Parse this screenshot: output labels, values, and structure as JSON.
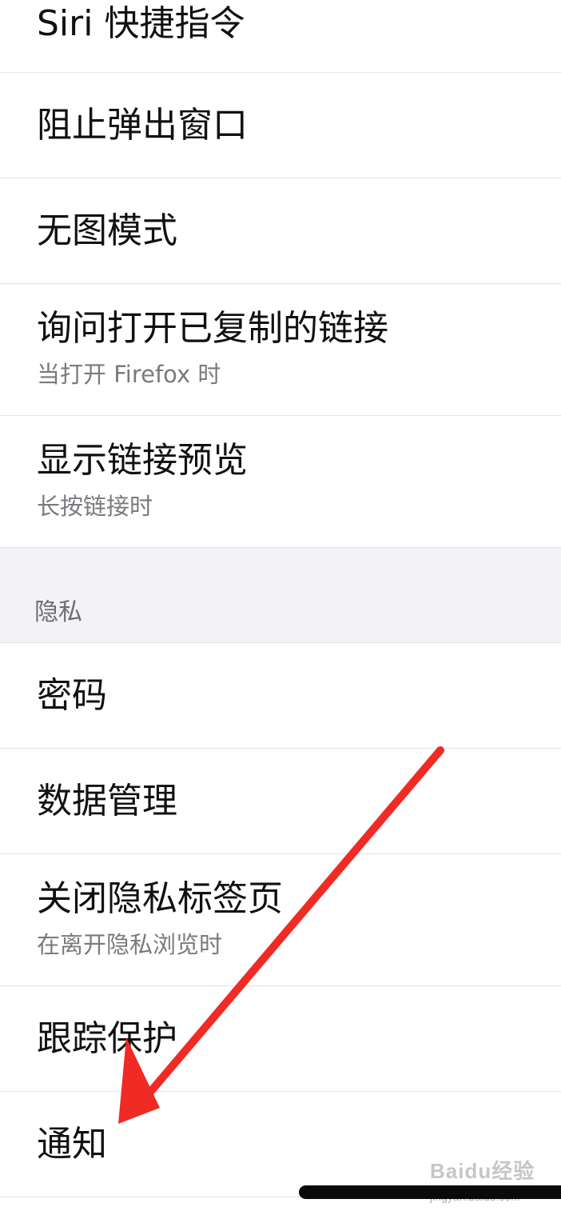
{
  "settings": {
    "items_top": [
      {
        "title": "Siri 快捷指令"
      },
      {
        "title": "阻止弹出窗口"
      },
      {
        "title": "无图模式"
      },
      {
        "title": "询问打开已复制的链接",
        "subtitle": "当打开 Firefox 时"
      },
      {
        "title": "显示链接预览",
        "subtitle": "长按链接时"
      }
    ],
    "privacy_header": "隐私",
    "items_privacy": [
      {
        "title": "密码"
      },
      {
        "title": "数据管理"
      },
      {
        "title": "关闭隐私标签页",
        "subtitle": "在离开隐私浏览时"
      },
      {
        "title": "跟踪保护"
      },
      {
        "title": "通知"
      }
    ]
  },
  "annotation": {
    "arrow_color": "#f02a24"
  },
  "watermark": {
    "logo_text": "Baidu经验",
    "url": "jingyan.baidu.com"
  },
  "colors": {
    "background": "#ffffff",
    "section_background": "#f2f2f7",
    "separator": "#e4e4e6",
    "title_text": "#111111",
    "subtitle_text": "#7a7a7e"
  }
}
